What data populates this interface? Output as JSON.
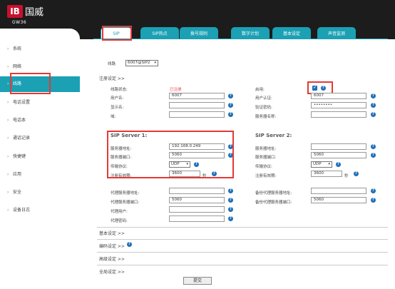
{
  "brand": {
    "logo_mark": "IB",
    "logo_text": "国威",
    "model": "GW36"
  },
  "sidebar": {
    "items": [
      {
        "label": "系统"
      },
      {
        "label": "网络"
      },
      {
        "label": "线路"
      },
      {
        "label": "电话设置"
      },
      {
        "label": "电话本"
      },
      {
        "label": "通话记录"
      },
      {
        "label": "快捷键"
      },
      {
        "label": "应用"
      },
      {
        "label": "安全"
      },
      {
        "label": "设备日志"
      }
    ]
  },
  "tabs": [
    {
      "label": "SIP"
    },
    {
      "label": "SIP热点"
    },
    {
      "label": "拨号规则"
    },
    {
      "label": "数字计划"
    },
    {
      "label": "基本设定"
    },
    {
      "label": "声音监测"
    }
  ],
  "line": {
    "label": "线路",
    "value": "6007@SIP2"
  },
  "register": {
    "section": "注册设定 >>",
    "status_label": "线路状态:",
    "status_value": "已注册",
    "enable_label": "启用:",
    "enable_checked": "✔",
    "username_label": "用户名:",
    "username_value": "6007",
    "auth_label": "用户认证:",
    "auth_value": "6007",
    "display_label": "显示名:",
    "display_value": "",
    "password_label": "验证密码:",
    "password_value": "••••••••",
    "domain_label": "域:",
    "domain_value": "",
    "server_name_label": "服务器名称:",
    "server_name_value": ""
  },
  "sip1": {
    "title": "SIP Server 1:",
    "addr_label": "服务器地址:",
    "addr_value": "192.168.0.249",
    "port_label": "服务器端口:",
    "port_value": "5060",
    "proto_label": "传输协议:",
    "proto_value": "UDP",
    "expire_label": "注册有效期:",
    "expire_value": "3600",
    "expire_unit": "秒"
  },
  "sip2": {
    "title": "SIP Server 2:",
    "addr_label": "服务器地址:",
    "addr_value": "",
    "port_label": "服务器端口:",
    "port_value": "5060",
    "proto_label": "传输协议:",
    "proto_value": "UDP",
    "expire_label": "注册有效期:",
    "expire_value": "3600",
    "expire_unit": "秒"
  },
  "proxy": {
    "addr_label": "代理服务器地址:",
    "addr_value": "",
    "port_label": "代理服务器端口:",
    "port_value": "5060",
    "user_label": "代理用户:",
    "user_value": "",
    "pass_label": "代理密码:",
    "pass_value": "",
    "backup_addr_label": "备份代理服务器地址:",
    "backup_addr_value": "",
    "backup_port_label": "备份代理服务器端口:",
    "backup_port_value": "5060"
  },
  "sections": {
    "basic": "基本设定 >>",
    "codec": "编码设定 >>",
    "advanced": "高级设定 >>",
    "dial": "全局设定 >>"
  },
  "submit_label": "提交",
  "help_glyph": "?",
  "colors": {
    "accent": "#1ba0b4",
    "highlight": "#e53935",
    "help": "#1e6fb8"
  }
}
